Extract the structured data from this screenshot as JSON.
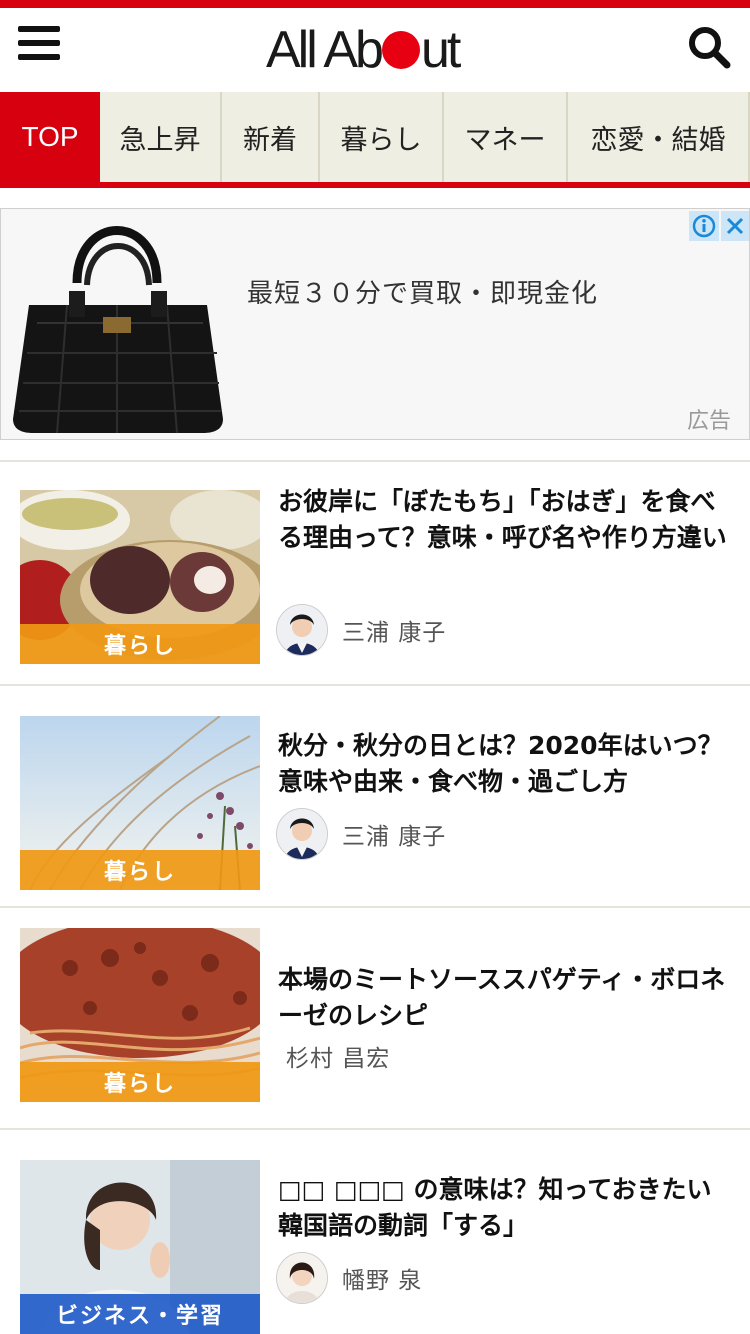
{
  "header": {
    "logo_text_left": "All Ab",
    "logo_text_right": "ut"
  },
  "tabs": [
    {
      "label": "TOP",
      "active": true
    },
    {
      "label": "急上昇",
      "active": false
    },
    {
      "label": "新着",
      "active": false
    },
    {
      "label": "暮らし",
      "active": false
    },
    {
      "label": "マネー",
      "active": false
    },
    {
      "label": "恋愛・結婚",
      "active": false
    }
  ],
  "ad": {
    "text": "最短３０分で買取・即現金化",
    "label": "広告"
  },
  "articles": [
    {
      "title": "お彼岸に「ぼたもち」「おはぎ」を食べる理由って？意味・呼び名や作り方違い",
      "category": "暮らし",
      "author": "三浦 康子"
    },
    {
      "title": "秋分・秋分の日とは？2020年はいつ？意味や由来・食べ物・過ごし方",
      "category": "暮らし",
      "author": "三浦 康子"
    },
    {
      "title": "本場のミートソーススパゲティ・ボロネーゼのレシピ",
      "category": "暮らし",
      "author": "杉村 昌宏"
    },
    {
      "title": "□□ □□□ の意味は？知っておきたい韓国語の動詞「する」",
      "category": "ビジネス・学習",
      "author": "幡野 泉"
    }
  ],
  "colors": {
    "brand_red": "#d7000f",
    "category_orange": "#f09814",
    "category_blue": "#1e5ac8",
    "tab_bg": "#efeee2"
  }
}
